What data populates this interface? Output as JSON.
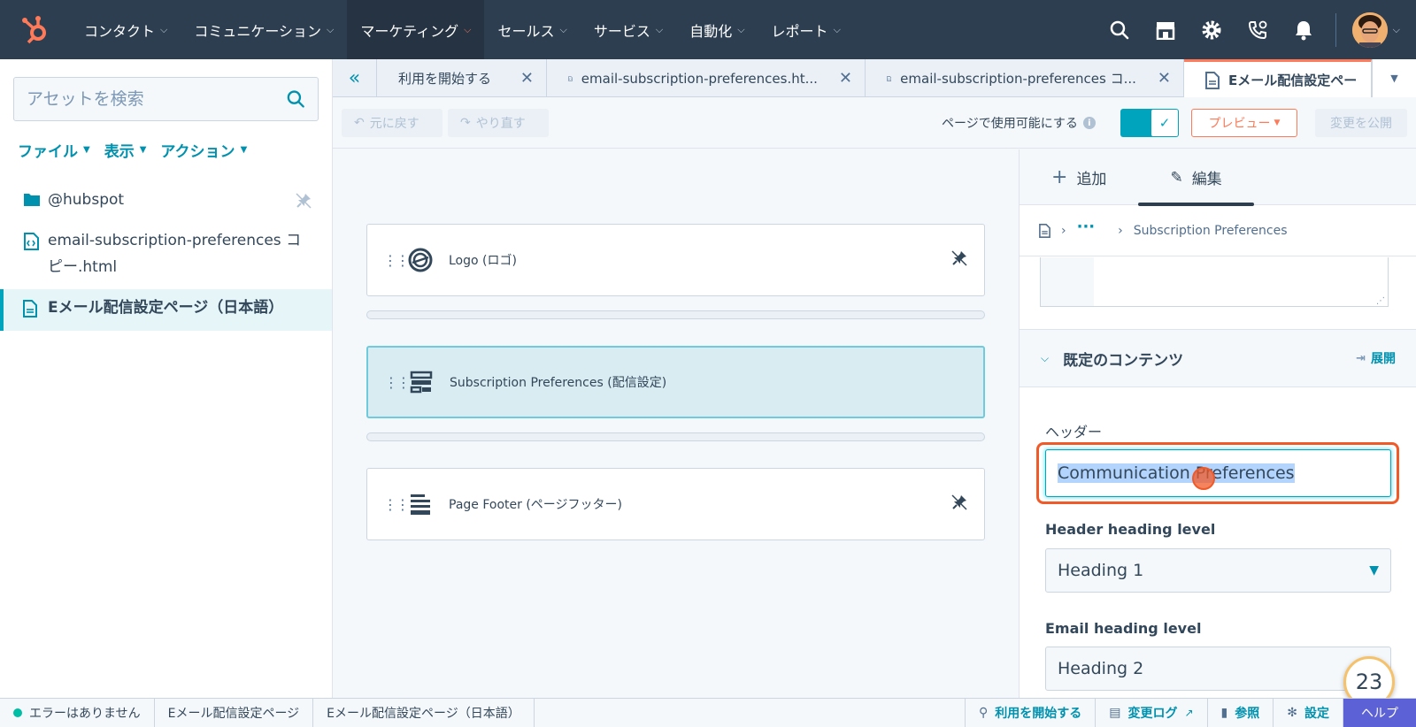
{
  "nav": {
    "items": [
      {
        "label": "コンタクト"
      },
      {
        "label": "コミュニケーション"
      },
      {
        "label": "マーケティング"
      },
      {
        "label": "セールス"
      },
      {
        "label": "サービス"
      },
      {
        "label": "自動化"
      },
      {
        "label": "レポート"
      }
    ],
    "active_index": 2
  },
  "sidebar": {
    "search_placeholder": "アセットを検索",
    "menu": [
      "ファイル",
      "表示",
      "アクション"
    ],
    "tree": [
      {
        "label": "@hubspot"
      },
      {
        "label": "email-subscription-preferences コピー.html"
      },
      {
        "label": "Eメール配信設定ページ（日本語）"
      }
    ]
  },
  "tabs": [
    {
      "label": "利用を開始する"
    },
    {
      "label": "email-subscription-preferences.ht..."
    },
    {
      "label": "email-subscription-preferences コ..."
    },
    {
      "label": "Eメール配信設定ペー"
    }
  ],
  "toolbar": {
    "undo": "元に戻す",
    "redo": "やり直す",
    "enable_label": "ページで使用可能にする",
    "preview": "プレビュー",
    "publish": "変更を公開"
  },
  "modules": [
    {
      "label": "Logo (ロゴ)"
    },
    {
      "label": "Subscription Preferences (配信設定)"
    },
    {
      "label": "Page Footer (ページフッター)"
    }
  ],
  "panel": {
    "tab_add": "追加",
    "tab_edit": "編集",
    "breadcrumb_more": "···",
    "breadcrumb_last": "Subscription Preferences",
    "section_title": "既定のコンテンツ",
    "expand": "展開",
    "header_label": "ヘッダー",
    "header_value": "Communication Preferences",
    "heading_level_label": "Header heading level",
    "heading_level_value": "Heading 1",
    "email_heading_label": "Email heading level",
    "email_heading_value": "Heading 2"
  },
  "badge": "23",
  "statusbar": {
    "status": "エラーはありません",
    "crumb1": "Eメール配信設定ページ",
    "crumb2": "Eメール配信設定ページ（日本語）",
    "get_started": "利用を開始する",
    "changelog": "変更ログ",
    "reference": "参照",
    "settings": "設定",
    "help": "ヘルプ"
  },
  "colors": {
    "nav_bg": "#2d3e50",
    "accent_orange": "#ff7a59",
    "teal": "#00a4bd",
    "highlight_red": "#f05a28"
  }
}
